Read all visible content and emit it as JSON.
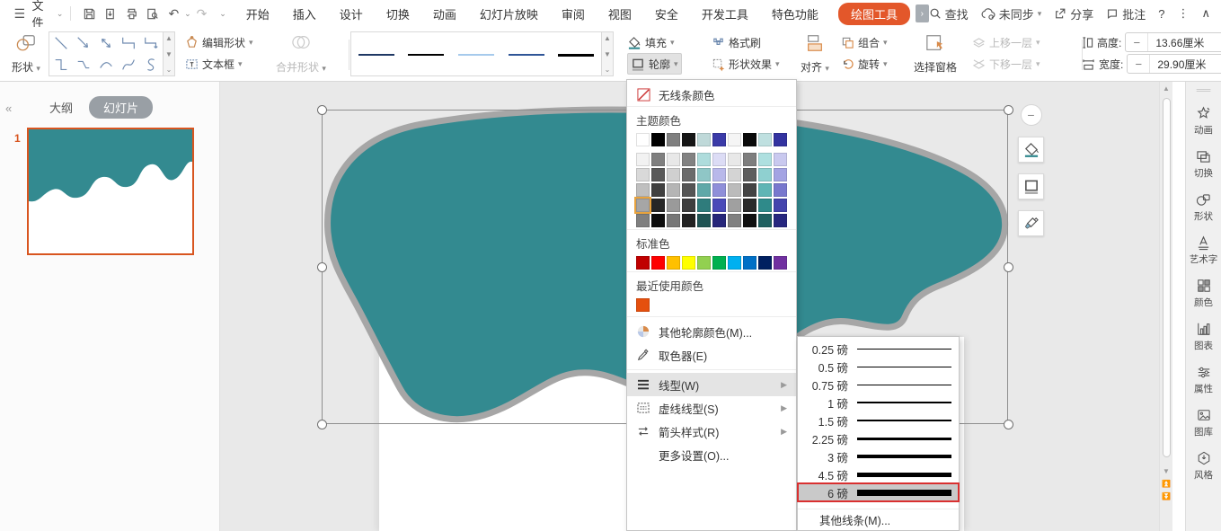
{
  "topbar": {
    "file_menu": "文件",
    "menus": [
      "开始",
      "插入",
      "设计",
      "切换",
      "动画",
      "幻灯片放映",
      "审阅",
      "视图",
      "安全",
      "开发工具",
      "特色功能"
    ],
    "drawing_tools_tab": "绘图工具",
    "search_label": "查找",
    "sync_label": "未同步",
    "share_label": "分享",
    "comment_label": "批注",
    "help_label": "?"
  },
  "ribbon": {
    "shapes_label": "形状",
    "edit_shape_label": "编辑形状",
    "textbox_label": "文本框",
    "merge_shapes_label": "合并形状",
    "fill_label": "填充",
    "format_painter_label": "格式刷",
    "outline_label": "轮廓",
    "shape_effects_label": "形状效果",
    "align_label": "对齐",
    "group_label": "组合",
    "rotate_label": "旋转",
    "selection_pane_label": "选择窗格",
    "bring_forward_label": "上移一层",
    "send_backward_label": "下移一层",
    "height_label": "高度:",
    "height_value": "13.66厘米",
    "width_label": "宽度:",
    "width_value": "29.90厘米",
    "line_gallery": [
      {
        "color": "#1F3864",
        "px": 2
      },
      {
        "color": "#000000",
        "px": 2
      },
      {
        "color": "#A6CAEC",
        "px": 2
      },
      {
        "color": "#2F5597",
        "px": 2
      },
      {
        "color": "#000000",
        "px": 3
      }
    ]
  },
  "left_panel": {
    "outline_tab": "大纲",
    "slides_tab": "幻灯片",
    "slide_number": "1"
  },
  "canvas": {
    "shape_fill": "#338A90",
    "shape_outline": "#A6A6A6"
  },
  "outline_menu": {
    "no_line_color": "无线条颜色",
    "theme_colors_label": "主题颜色",
    "theme_grid": [
      [
        "#FFFFFF",
        "#000000",
        "#7F7F7F",
        "#161616",
        "#BFD9D9",
        "#3B3BA8",
        "#F5F5F5",
        "#0A0A0A",
        "#BFE0E0",
        "#3333A0"
      ],
      [
        "#F2F2F2",
        "#7F7F7F",
        "#E8E8E8",
        "#828282",
        "#AEDCDC",
        "#DCDCF5",
        "#E8E8E8",
        "#7E7E7E",
        "#AEE0E0",
        "#C9C9EF"
      ],
      [
        "#D9D9D9",
        "#595959",
        "#D0D0D0",
        "#6B6B6B",
        "#8FC6C6",
        "#B8B8EA",
        "#D4D4D4",
        "#5E5E5E",
        "#8FD0D0",
        "#A3A3E3"
      ],
      [
        "#BFBFBF",
        "#404040",
        "#B5B5B5",
        "#555555",
        "#5FA8A8",
        "#8F8FD9",
        "#BBBBBB",
        "#434343",
        "#5FB5B5",
        "#7878CE"
      ],
      [
        "#A6A6A6",
        "#262626",
        "#9A9A9A",
        "#3E3E3E",
        "#2F7C7C",
        "#4A4AB8",
        "#A0A0A0",
        "#2A2A2A",
        "#2F8A8A",
        "#4444AD"
      ],
      [
        "#7F7F7F",
        "#0D0D0D",
        "#777777",
        "#222222",
        "#1F5454",
        "#26267A",
        "#808080",
        "#101010",
        "#1F6060",
        "#27277F"
      ]
    ],
    "selected_cell": {
      "row": 4,
      "col": 0
    },
    "standard_label": "标准色",
    "standard_colors": [
      "#C00000",
      "#FE0000",
      "#FFC000",
      "#FFFF00",
      "#92D050",
      "#00B050",
      "#00B0F0",
      "#0070C6",
      "#002060",
      "#7030A0"
    ],
    "recent_label": "最近使用颜色",
    "recent_colors": [
      "#E5500E"
    ],
    "more_outline_colors": "其他轮廓颜色(M)...",
    "eyedropper": "取色器(E)",
    "line_style": "线型(W)",
    "dash_style": "虚线线型(S)",
    "arrow_style": "箭头样式(R)",
    "more_settings": "更多设置(O)..."
  },
  "line_weight_menu": {
    "items": [
      {
        "label": "0.25 磅",
        "px": 1,
        "selected": false
      },
      {
        "label": "0.5 磅",
        "px": 1.3,
        "selected": false
      },
      {
        "label": "0.75 磅",
        "px": 1.7,
        "selected": false
      },
      {
        "label": "1 磅",
        "px": 2,
        "selected": false
      },
      {
        "label": "1.5 磅",
        "px": 2.5,
        "selected": false
      },
      {
        "label": "2.25 磅",
        "px": 3,
        "selected": false
      },
      {
        "label": "3 磅",
        "px": 4,
        "selected": false
      },
      {
        "label": "4.5 磅",
        "px": 5.5,
        "selected": false
      },
      {
        "label": "6 磅",
        "px": 7,
        "selected": true
      }
    ],
    "more": "其他线条(M)..."
  },
  "right_sidebar": {
    "items": [
      {
        "label": "动画",
        "icon": "animation-icon"
      },
      {
        "label": "切换",
        "icon": "transition-icon"
      },
      {
        "label": "形状",
        "icon": "shapes-icon"
      },
      {
        "label": "艺术字",
        "icon": "wordart-icon"
      },
      {
        "label": "颜色",
        "icon": "colors-icon"
      },
      {
        "label": "图表",
        "icon": "chart-icon"
      },
      {
        "label": "属性",
        "icon": "properties-icon"
      },
      {
        "label": "图库",
        "icon": "gallery-icon"
      },
      {
        "label": "风格",
        "icon": "style-icon"
      }
    ]
  }
}
